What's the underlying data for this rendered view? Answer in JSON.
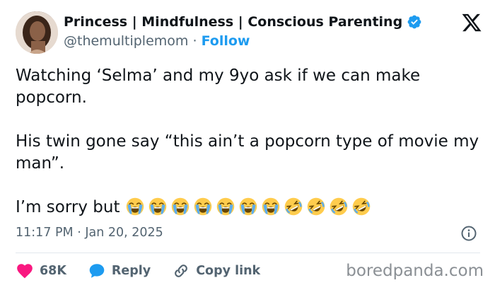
{
  "author": {
    "display_name": "Princess | Mindfulness | Conscious Parenting",
    "handle": "@themultiplemom",
    "separator": "·",
    "follow_label": "Follow"
  },
  "tweet": {
    "line1": "Watching ‘Selma’ and my 9yo ask if we can make popcorn.",
    "line2": "His twin gone say “this ain’t a popcorn type of movie my man”.",
    "line3_prefix": "I’m sorry but ",
    "emojis": [
      "loudly-crying-face",
      "loudly-crying-face",
      "loudly-crying-face",
      "loudly-crying-face",
      "loudly-crying-face",
      "loudly-crying-face",
      "loudly-crying-face",
      "rolling-on-floor-laughing",
      "rolling-on-floor-laughing",
      "rolling-on-floor-laughing",
      "rolling-on-floor-laughing"
    ]
  },
  "meta": {
    "timestamp": "11:17 PM · Jan 20, 2025"
  },
  "actions": {
    "likes": "68K",
    "reply_label": "Reply",
    "copy_link_label": "Copy link"
  },
  "watermark": "boredpanda.com",
  "colors": {
    "accent": "#1d9bf0",
    "like": "#f91880",
    "muted": "#536471"
  }
}
